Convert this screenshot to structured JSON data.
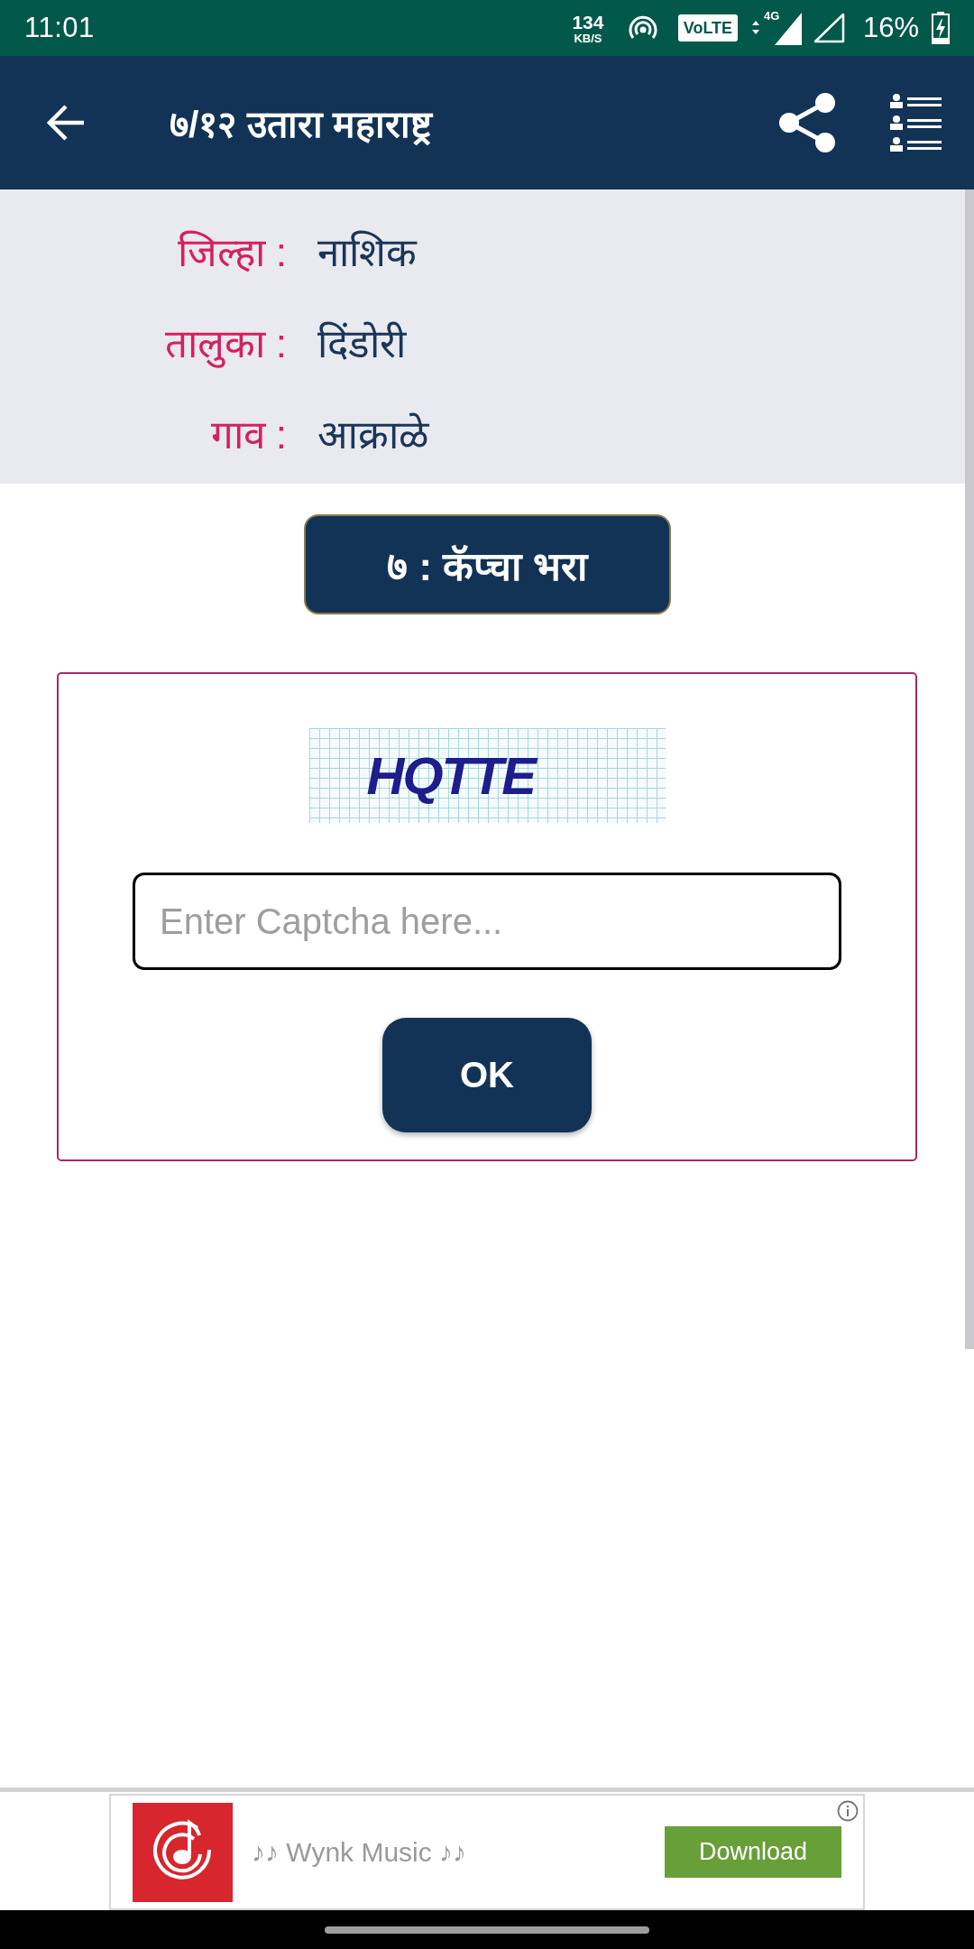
{
  "status_bar": {
    "time": "11:01",
    "data_speed": "134",
    "data_unit": "KB/S",
    "volte": "VoLTE",
    "network": "4G",
    "battery": "16%"
  },
  "app_bar": {
    "title": "७/१२ उतारा महाराष्ट्र"
  },
  "location": [
    {
      "label": "जिल्हा :",
      "value": "नाशिक"
    },
    {
      "label": "तालुका :",
      "value": "दिंडोरी"
    },
    {
      "label": "गाव :",
      "value": "आक्राळे"
    }
  ],
  "step_heading": "७ : कॅप्चा भरा",
  "captcha": {
    "text": "HQTTE",
    "input": {
      "placeholder": "Enter Captcha here..."
    },
    "button": "OK"
  },
  "ad": {
    "title": "♪♪ Wynk Music ♪♪",
    "button": "Download"
  }
}
